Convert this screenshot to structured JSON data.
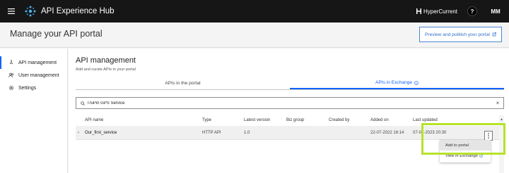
{
  "topbar": {
    "app_title": "API Experience Hub",
    "brand_label": "HyperCurrent",
    "help_label": "?",
    "user_initials": "MM",
    "icons": [
      "hamburger-menu-icon",
      "api-hub-logo",
      "hypercurrent-icon",
      "help-icon"
    ]
  },
  "header": {
    "page_title": "Manage your API portal",
    "publish_button": "Preview and publish your portal"
  },
  "sidebar": {
    "items": [
      {
        "label": "API management",
        "icon": "api-icon",
        "active": true
      },
      {
        "label": "User management",
        "icon": "users-icon",
        "active": false
      },
      {
        "label": "Settings",
        "icon": "gear-icon",
        "active": false
      }
    ]
  },
  "main": {
    "title": "API management",
    "subtitle": "Add and curate APIs in your portal",
    "tabs": [
      {
        "label": "APIs in the portal",
        "active": false
      },
      {
        "label": "APIs in Exchange",
        "active": true
      }
    ],
    "search": {
      "value": "TruPin GPS Service",
      "placeholder": "Search"
    }
  },
  "table": {
    "columns": [
      "API name",
      "Type",
      "Latest version",
      "Biz group",
      "Created by",
      "Added on",
      "Last updated"
    ],
    "rows": [
      {
        "name": "Our_first_service",
        "type": "HTTP API",
        "version": "1.0",
        "biz_group": "",
        "created_by": "",
        "added_on": "22-07-2022 16:14",
        "last_updated": "07-08-2023 20:30"
      }
    ]
  },
  "row_menu": {
    "items": [
      {
        "label": "Add to portal"
      },
      {
        "label": "View in Exchange"
      }
    ]
  },
  "colors": {
    "accent": "#0f62fe",
    "highlight": "#b7e22b",
    "topbar": "#161616"
  }
}
